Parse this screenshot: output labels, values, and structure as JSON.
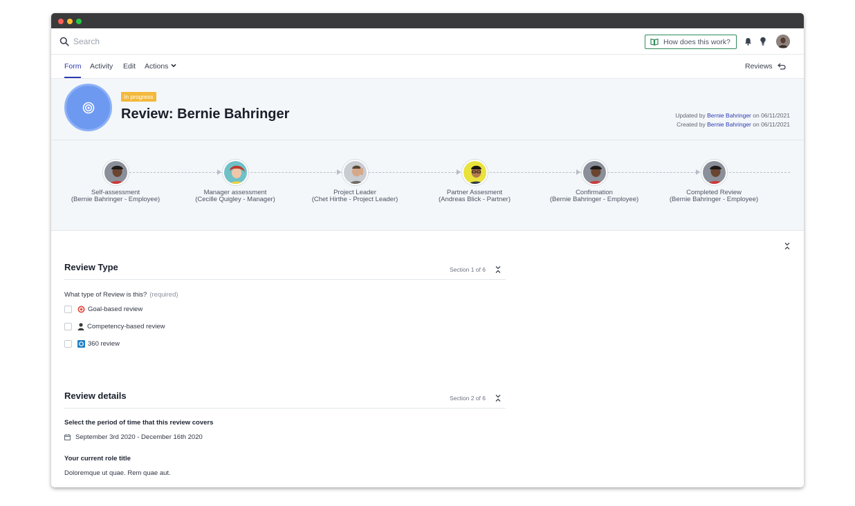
{
  "topbar": {
    "search_placeholder": "Search",
    "help_label": "How does this work?"
  },
  "tabs": [
    {
      "label": "Form",
      "active": true
    },
    {
      "label": "Activity"
    },
    {
      "label": "Edit"
    },
    {
      "label": "Actions"
    }
  ],
  "reviews_link": "Reviews",
  "header": {
    "status": "In progress",
    "title": "Review: Bernie Bahringer",
    "updated_prefix": "Updated by",
    "updated_user": "Bernie Bahringer",
    "updated_suffix": "on 06/11/2021",
    "created_prefix": "Created by",
    "created_user": "Bernie Bahringer",
    "created_suffix": "on 06/11/2021"
  },
  "steps": [
    {
      "name": "Self-assessment",
      "sub": "(Bernie Bahringer - Employee)"
    },
    {
      "name": "Manager assessment",
      "sub": "(Cecille Quigley - Manager)"
    },
    {
      "name": "Project Leader",
      "sub": "(Chet Hirthe - Project Leader)"
    },
    {
      "name": "Partner Assesment",
      "sub": "(Andreas Blick - Partner)"
    },
    {
      "name": "Confirmation",
      "sub": "(Bernie Bahringer - Employee)"
    },
    {
      "name": "Completed Review",
      "sub": "(Bernie Bahringer - Employee)"
    }
  ],
  "sections": [
    {
      "title": "Review Type",
      "meta": "Section 1 of 6",
      "question": "What type of Review is this?",
      "required": "(required)",
      "options": [
        {
          "label": "Goal-based review",
          "icon": "target-icon"
        },
        {
          "label": "Competency-based review",
          "icon": "person-icon"
        },
        {
          "label": "360 review",
          "icon": "360-icon"
        }
      ]
    },
    {
      "title": "Review details",
      "meta": "Section 2 of 6",
      "period_label": "Select the period of time that this review covers",
      "period_value": "September 3rd 2020 - December 16th 2020",
      "role_label": "Your current role title",
      "role_value": "Doloremque ut quae. Rem quae aut."
    }
  ],
  "colors": {
    "accent": "#2b3ab2",
    "status": "#f3b93c",
    "help_border": "#2f8a5a",
    "header_bg": "#f4f7f9"
  }
}
